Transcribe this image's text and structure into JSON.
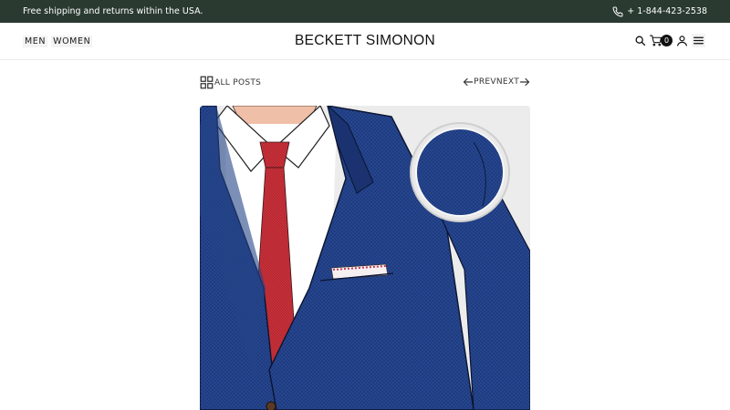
{
  "announcement": {
    "text": "Free shipping and returns within the USA.",
    "phone": "+ 1-844-423-2538"
  },
  "header": {
    "nav": [
      "MEN",
      "WOMEN"
    ],
    "brand": "BECKETT SIMONON",
    "cart_count": "0",
    "icons": [
      "search-icon",
      "cart-icon",
      "account-icon",
      "menu-icon"
    ]
  },
  "post_nav": {
    "all_posts": "ALL POSTS",
    "prev": "PREV",
    "next": "NEXT"
  },
  "colors": {
    "announcement_bg": "#2a3a30",
    "suit_navy": "#1f3a78",
    "tie_red": "#b8262f",
    "hero_bg": "#ececec"
  }
}
